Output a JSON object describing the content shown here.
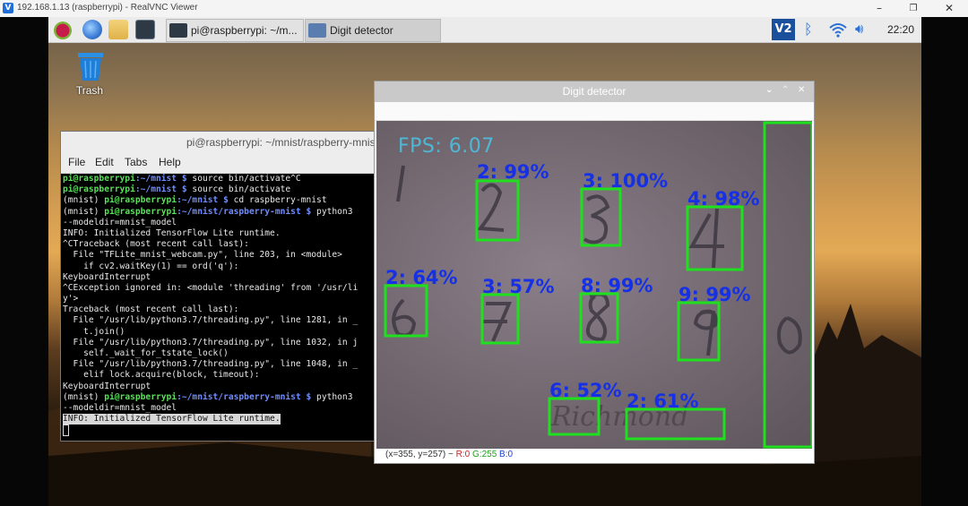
{
  "viewer": {
    "title": "192.168.1.13 (raspberrypi) - RealVNC Viewer",
    "logo_text": "V2",
    "minimize": "–",
    "restore": "❐",
    "close": "✕"
  },
  "taskbar": {
    "tasks": [
      {
        "label": "pi@raspberrypi: ~/m..."
      },
      {
        "label": "Digit detector"
      }
    ],
    "tray_vnc": "V2",
    "clock": "22:20"
  },
  "desktop": {
    "trash_label": "Trash"
  },
  "terminal": {
    "title": "pi@raspberrypi: ~/mnist/raspberry-mnist",
    "menus": [
      "File",
      "Edit",
      "Tabs",
      "Help"
    ],
    "lines": [
      {
        "user": "pi@raspberrypi",
        "path": ":~/mnist $",
        "text": " source bin/activate^C"
      },
      {
        "user": "pi@raspberrypi",
        "path": ":~/mnist $",
        "text": " source bin/activate"
      },
      {
        "prefix": "(mnist) ",
        "user": "pi@raspberrypi",
        "path": ":~/mnist $",
        "text": " cd raspberry-mnist"
      },
      {
        "prefix": "(mnist) ",
        "user": "pi@raspberrypi",
        "path": ":~/mnist/raspberry-mnist $",
        "text": " python3"
      },
      {
        "text": "--modeldir=mnist_model"
      },
      {
        "text": "INFO: Initialized TensorFlow Lite runtime."
      },
      {
        "text": "^CTraceback (most recent call last):"
      },
      {
        "text": "  File \"TFLite_mnist_webcam.py\", line 203, in <module>"
      },
      {
        "text": "    if cv2.waitKey(1) == ord('q'):"
      },
      {
        "text": "KeyboardInterrupt"
      },
      {
        "text": "^CException ignored in: <module 'threading' from '/usr/li"
      },
      {
        "text": "y'>"
      },
      {
        "text": "Traceback (most recent call last):"
      },
      {
        "text": "  File \"/usr/lib/python3.7/threading.py\", line 1281, in _"
      },
      {
        "text": "    t.join()"
      },
      {
        "text": "  File \"/usr/lib/python3.7/threading.py\", line 1032, in j"
      },
      {
        "text": "    self._wait_for_tstate_lock()"
      },
      {
        "text": "  File \"/usr/lib/python3.7/threading.py\", line 1048, in _"
      },
      {
        "text": "    elif lock.acquire(block, timeout):"
      },
      {
        "text": "KeyboardInterrupt"
      },
      {
        "prefix": "(mnist) ",
        "user": "pi@raspberrypi",
        "path": ":~/mnist/raspberry-mnist $",
        "text": " python3"
      },
      {
        "text": "--modeldir=mnist_model"
      },
      {
        "text": "INFO: Initialized TensorFlow Lite runtime.",
        "highlight": true
      }
    ]
  },
  "detector": {
    "title": "Digit detector",
    "fps": "FPS: 6.07",
    "detections": [
      {
        "label": "2: 99%"
      },
      {
        "label": "3: 100%"
      },
      {
        "label": "4: 98%"
      },
      {
        "label": "2: 64%"
      },
      {
        "label": "3: 57%"
      },
      {
        "label": "8: 99%"
      },
      {
        "label": "9: 99%"
      },
      {
        "label": "6: 52%"
      },
      {
        "label": "2: 61%"
      }
    ],
    "status": {
      "coords": "(x=355, y=257) ~",
      "r": "R:0",
      "g": "G:255",
      "b": "B:0"
    }
  }
}
